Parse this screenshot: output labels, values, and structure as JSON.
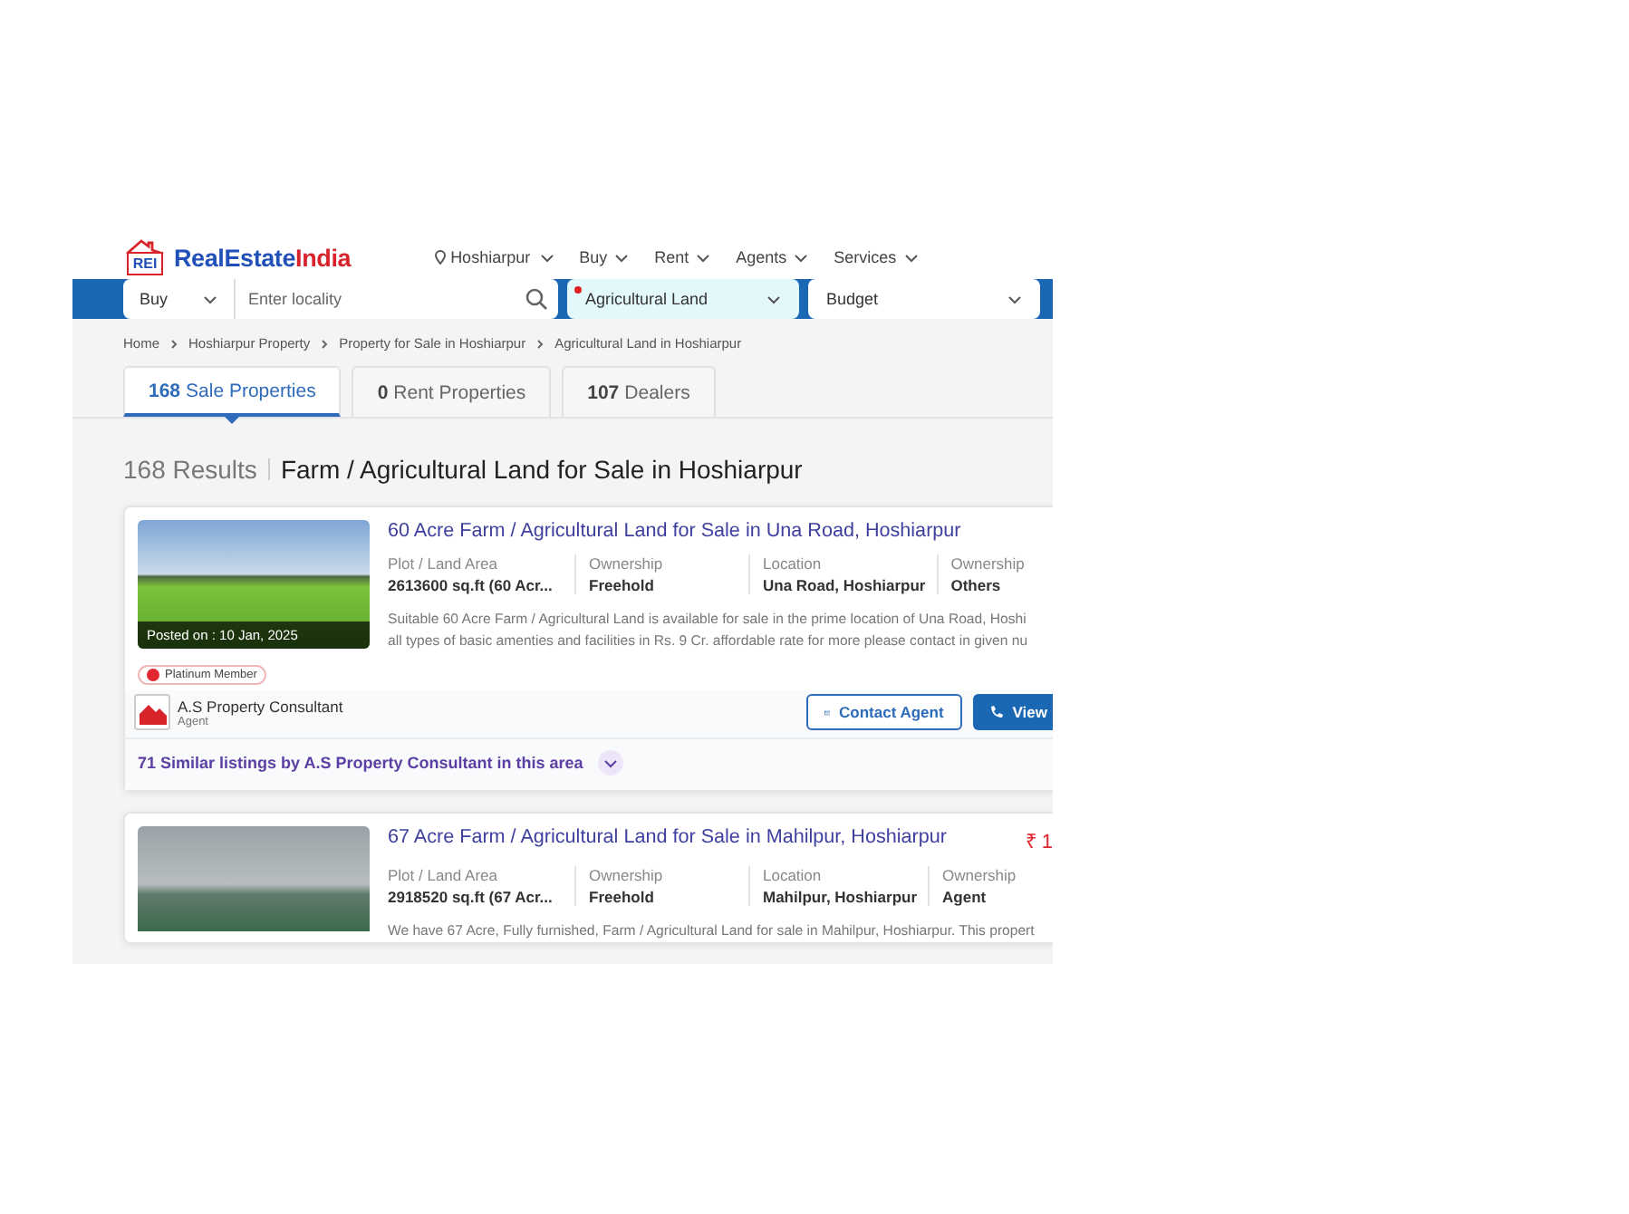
{
  "logo": {
    "badge": "REI",
    "name_main": "RealEstate",
    "name_accent": "India"
  },
  "header": {
    "location": "Hoshiarpur",
    "nav": [
      "Buy",
      "Rent",
      "Agents",
      "Services"
    ]
  },
  "search": {
    "mode": "Buy",
    "placeholder": "Enter locality",
    "property_type": "Agricultural Land",
    "budget": "Budget"
  },
  "breadcrumbs": [
    "Home",
    "Hoshiarpur Property",
    "Property for Sale in Hoshiarpur",
    "Agricultural Land in Hoshiarpur"
  ],
  "tabs": [
    {
      "count": "168",
      "label": "Sale Properties",
      "selected": true
    },
    {
      "count": "0",
      "label": "Rent Properties",
      "selected": false
    },
    {
      "count": "107",
      "label": "Dealers",
      "selected": false
    }
  ],
  "results": {
    "count": "168 Results",
    "heading": "Farm / Agricultural Land for Sale in Hoshiarpur"
  },
  "listings": [
    {
      "title": "60 Acre Farm / Agricultural Land for Sale in Una Road, Hoshiarpur",
      "posted": "Posted on : 10 Jan, 2025",
      "facts": [
        {
          "label": "Plot / Land Area",
          "value": "2613600 sq.ft (60 Acr..."
        },
        {
          "label": "Ownership",
          "value": "Freehold"
        },
        {
          "label": "Location",
          "value": "Una Road, Hoshiarpur"
        },
        {
          "label": "Ownership",
          "value": "Others"
        }
      ],
      "description": [
        "Suitable 60 Acre Farm / Agricultural Land is available for sale in the prime location of Una Road, Hoshi",
        "all types of basic amenties and facilities in Rs. 9 Cr. affordable rate for more please contact in given nu"
      ],
      "member_badge": "Platinum Member",
      "agent": {
        "name": "A.S Property Consultant",
        "role": "Agent"
      },
      "buttons": [
        {
          "kind": "outline",
          "label": "Contact Agent"
        },
        {
          "kind": "solid",
          "label": "View"
        }
      ],
      "similar": "71 Similar listings by A.S Property Consultant in this area"
    },
    {
      "title": "67 Acre Farm / Agricultural Land for Sale in Mahilpur, Hoshiarpur",
      "price": "₹ 1",
      "facts": [
        {
          "label": "Plot / Land Area",
          "value": "2918520 sq.ft (67 Acr..."
        },
        {
          "label": "Ownership",
          "value": "Freehold"
        },
        {
          "label": "Location",
          "value": "Mahilpur, Hoshiarpur"
        },
        {
          "label": "Ownership",
          "value": "Agent"
        }
      ],
      "description": [
        "We have 67 Acre, Fully furnished, Farm / Agricultural Land for sale in Mahilpur, Hoshiarpur. This propert"
      ]
    }
  ]
}
